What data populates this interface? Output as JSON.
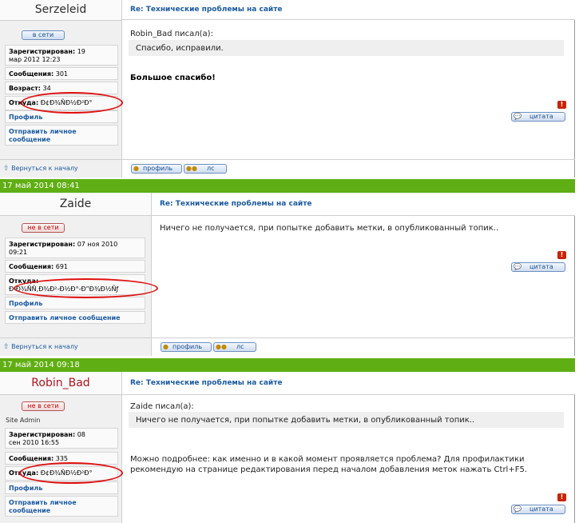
{
  "thread_subject": "Re: Технические проблемы на сайте",
  "labels": {
    "registered": "Зарегистрирован:",
    "messages": "Сообщения:",
    "age": "Возраст:",
    "from": "Откуда:",
    "profile_link": "Профиль",
    "pm_link_short_1": "Отправить личное",
    "pm_link_short_2": "сообщение",
    "pm_link_long": "Отправить личное сообщение",
    "back_to_top": "Вернуться к началу",
    "quote_btn": "цитата",
    "profile_btn": "профиль",
    "pm_btn": "лс",
    "report_btn": "!"
  },
  "posts": [
    {
      "author": "Serzeleid",
      "status": "в сети",
      "registered_1": "19",
      "registered_2": "мар 2012 12:23",
      "messages": "301",
      "age": "34",
      "from": "Ð¢Ð¾ÑÐ½Ð²Ð°",
      "quote_author": "Robin_Bad писал(а):",
      "quote_text": "Спасибо, исправили.",
      "body": "Большое спасибо!"
    },
    {
      "date": "17 май 2014 08:41",
      "author": "Zaide",
      "status": "не в сети",
      "registered_1": "07 ноя 2010",
      "registered_2": "09:21",
      "messages": "691",
      "from": "Ð Ð¾ÑÑ‚Ð¾Ð²-Ð½Ð°-Ð”Ð¾Ð½Ñƒ",
      "body": "Ничего не получается, при попытке добавить метки, в опубликованный топик.."
    },
    {
      "date": "17 май 2014 09:18",
      "author": "Robin_Bad",
      "status": "не в сети",
      "rank": "Site Admin",
      "registered_1": "08",
      "registered_2": "сен 2010 16:55",
      "messages": "335",
      "from": "Ð¢Ð¾ÑÐ½Ð²Ð°",
      "quote_author": "Zaide писал(а):",
      "quote_text": "Ничего не получается, при попытке добавить метки, в опубликованный топик..",
      "body_1": "Можно подробнее: как именно и в какой момент проявляется проблема? Для профилактики",
      "body_2": "рекомендую на странице редактирования перед началом добавления меток нажать Ctrl+F5."
    }
  ],
  "colors": {
    "date_bar": "#5fae13",
    "link": "#1c5aa1",
    "admin_name": "#b0131e",
    "highlight_oval": "#e01010"
  }
}
